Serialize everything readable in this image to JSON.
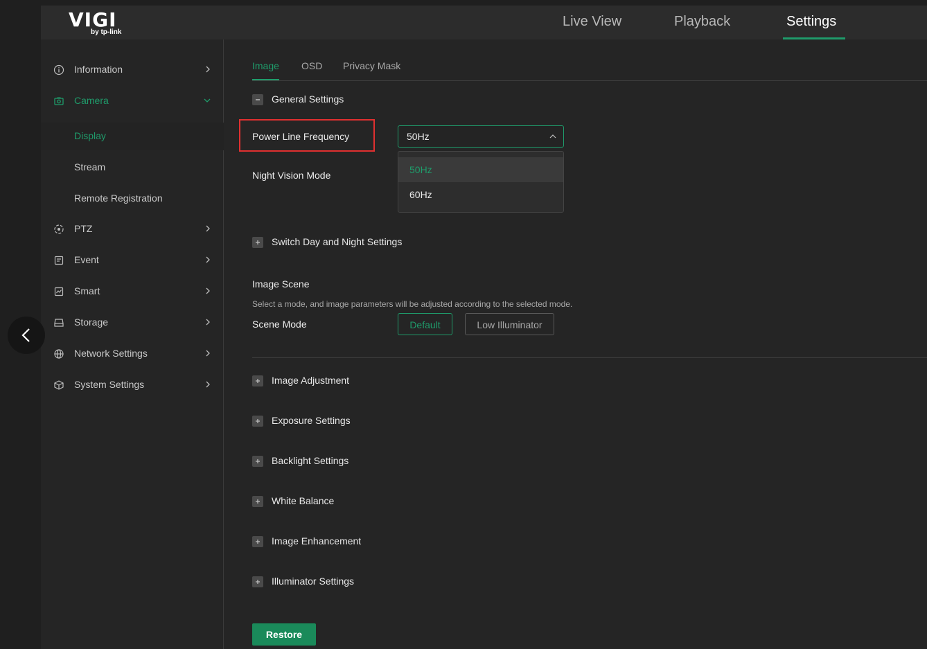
{
  "brand": {
    "logo": "VIGI",
    "tagline": "by tp-link"
  },
  "topnav": [
    {
      "label": "Live View"
    },
    {
      "label": "Playback"
    },
    {
      "label": "Settings",
      "active": true
    }
  ],
  "sidebar": {
    "items": [
      {
        "label": "Information",
        "icon": "info-icon"
      },
      {
        "label": "Camera",
        "icon": "camera-icon",
        "expanded": true
      },
      {
        "label": "PTZ",
        "icon": "ptz-icon"
      },
      {
        "label": "Event",
        "icon": "event-icon"
      },
      {
        "label": "Smart",
        "icon": "smart-icon"
      },
      {
        "label": "Storage",
        "icon": "storage-icon"
      },
      {
        "label": "Network Settings",
        "icon": "globe-icon"
      },
      {
        "label": "System Settings",
        "icon": "cube-icon"
      }
    ],
    "camera_sub": [
      {
        "label": "Display",
        "selected": true
      },
      {
        "label": "Stream"
      },
      {
        "label": "Remote Registration"
      }
    ]
  },
  "tabs": [
    {
      "label": "Image",
      "active": true
    },
    {
      "label": "OSD"
    },
    {
      "label": "Privacy Mask"
    }
  ],
  "general": {
    "title": "General Settings",
    "power_line_label": "Power Line Frequency",
    "power_line_value": "50Hz",
    "power_line_options": [
      "50Hz",
      "60Hz"
    ],
    "night_vision_label": "Night Vision Mode"
  },
  "switch_day_night": "Switch Day and Night Settings",
  "image_scene": {
    "title": "Image Scene",
    "description": "Select a mode, and image parameters will be adjusted according to the selected mode.",
    "scene_mode_label": "Scene Mode",
    "buttons": [
      "Default",
      "Low Illuminator"
    ],
    "selected": "Default"
  },
  "sections": [
    "Image Adjustment",
    "Exposure Settings",
    "Backlight Settings",
    "White Balance",
    "Image Enhancement",
    "Illuminator Settings"
  ],
  "restore_label": "Restore",
  "colors": {
    "accent": "#1f9c6b",
    "highlight": "#e03030",
    "background": "#252525"
  }
}
